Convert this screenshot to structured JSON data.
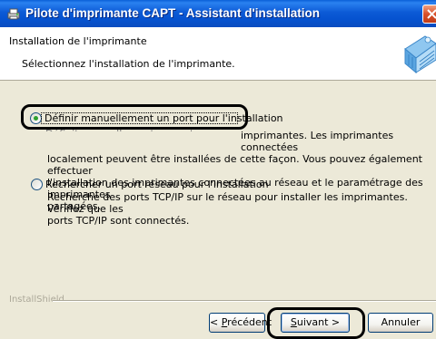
{
  "window": {
    "title": "Pilote d'imprimante CAPT - Assistant d'installation"
  },
  "header": {
    "title": "Installation de l'imprimante",
    "subtitle": "Sélectionnez l'installation de l'imprimante."
  },
  "options": [
    {
      "label": "Définir manuellement un port pour l'installation",
      "selected": true,
      "description_lines": [
        "imprimantes. Les imprimantes connectées",
        "localement peuvent être installées de cette façon. Vous pouvez également effectuer",
        "l'installation des imprimantes connectées au réseau et le paramétrage des imprimantes",
        "partagées."
      ]
    },
    {
      "label": "Rechercher un port réseau pour l'installation",
      "selected": false,
      "description_lines": [
        "Recherche des ports TCP/IP sur le réseau pour installer les imprimantes. Vérifiez que les",
        "ports TCP/IP sont connectés."
      ]
    }
  ],
  "footer": {
    "brand": "InstallShield",
    "back_label": "Précédent",
    "back_mnemonic": "P",
    "back_rest": "récédent",
    "next_label": "Suivant >",
    "next_mnemonic": "S",
    "next_rest": "uivant >",
    "cancel_label": "Annuler"
  },
  "colors": {
    "titlebar": "#0c5ad6",
    "dialog_bg": "#ece9d8",
    "radio_selected": "#2ea02e"
  },
  "icons": {
    "title": "printer-setup-icon",
    "close": "close-x-icon",
    "header": "printer-network-graphic"
  }
}
